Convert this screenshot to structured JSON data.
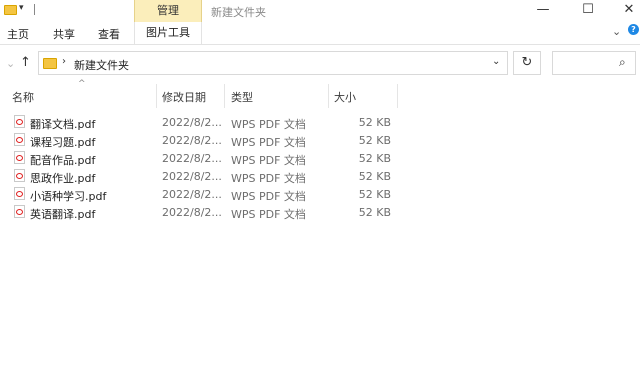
{
  "window": {
    "title": "新建文件夹",
    "context_tab": "管理",
    "controls": [
      "—",
      "☐",
      "✕"
    ]
  },
  "ribbon": {
    "tabs": [
      "主页",
      "共享",
      "查看",
      "图片工具"
    ],
    "help": "?"
  },
  "address": {
    "path": "新建文件夹"
  },
  "columns": {
    "name": "名称",
    "date": "修改日期",
    "type": "类型",
    "size": "大小"
  },
  "files": [
    {
      "name": "翻译文档.pdf",
      "date": "2022/8/2...",
      "type": "WPS PDF 文档",
      "size": "52 KB"
    },
    {
      "name": "课程习题.pdf",
      "date": "2022/8/2...",
      "type": "WPS PDF 文档",
      "size": "52 KB"
    },
    {
      "name": "配音作品.pdf",
      "date": "2022/8/2...",
      "type": "WPS PDF 文档",
      "size": "52 KB"
    },
    {
      "name": "思政作业.pdf",
      "date": "2022/8/2...",
      "type": "WPS PDF 文档",
      "size": "52 KB"
    },
    {
      "name": "小语种学习.pdf",
      "date": "2022/8/2...",
      "type": "WPS PDF 文档",
      "size": "52 KB"
    },
    {
      "name": "英语翻译.pdf",
      "date": "2022/8/2...",
      "type": "WPS PDF 文档",
      "size": "52 KB"
    }
  ],
  "colors": {
    "context_tab_bg": "#fbeebb",
    "folder_yellow": "#f4c542",
    "pdf_red": "#e02020",
    "help_blue": "#1e88e5"
  }
}
